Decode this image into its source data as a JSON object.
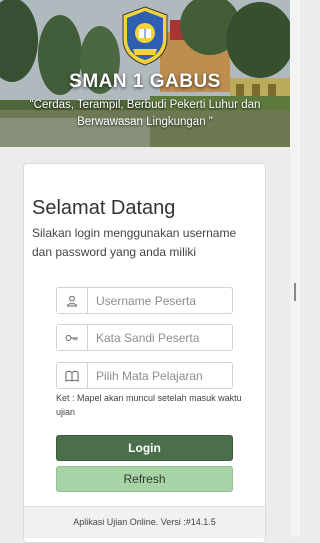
{
  "header": {
    "school_name": "SMAN 1 GABUS",
    "tagline": "\"Cerdas, Terampil, Berbudi Pekerti Luhur dan Berwawasan Lingkungan \""
  },
  "login": {
    "title": "Selamat Datang",
    "description": "Silakan login menggunakan username dan password yang anda miliki",
    "username": {
      "placeholder": "Username Peserta",
      "value": "",
      "icon": "user-icon"
    },
    "password": {
      "placeholder": "Kata Sandi Peserta",
      "value": "",
      "icon": "key-icon"
    },
    "subject": {
      "placeholder": "Pilih Mata Pelajaran",
      "value": "",
      "icon": "book-icon"
    },
    "note": "Ket : Mapel akan muncul setelah masuk waktu ujian",
    "login_button": "Login",
    "refresh_button": "Refresh"
  },
  "footer": {
    "text": "Aplikasi Ujian Online. Versi :#14.1.5"
  },
  "colors": {
    "login_button": "#4a6f4a",
    "refresh_button": "#a8d3a6",
    "card_bg": "#ffffff",
    "page_bg": "#ececec"
  }
}
